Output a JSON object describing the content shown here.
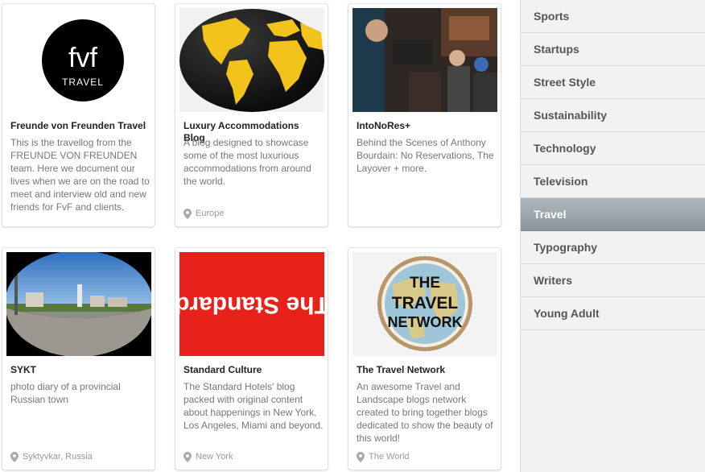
{
  "cards": [
    {
      "title": "Freunde von Freunden Travel",
      "description": "This is the travellog from the FREUNDE VON FREUNDEN team. Here we document our lives when we are on the road to meet and interview old and new friends for FvF and clients.",
      "location": "",
      "logo_text": "fvf",
      "logo_subtext": "TRAVEL"
    },
    {
      "title": "Luxury Accommodations Blog",
      "description": "A blog designed to showcase some of the most luxurious accommodations from around the world.",
      "location": "Europe"
    },
    {
      "title": "IntoNoRes+",
      "description": "Behind the Scenes of Anthony Bourdain: No Reservations, The Layover + more.",
      "location": ""
    },
    {
      "title": "SYKT",
      "description": "photo diary of a provincial Russian town",
      "location": "Syktyvkar, Russia"
    },
    {
      "title": "Standard Culture",
      "description": "The Standard Hotels' blog packed with original content about happenings in New York, Los Angeles, Miami and beyond.",
      "location": "New York",
      "logo_text": "The Standard"
    },
    {
      "title": "The Travel Network",
      "description": "An awesome Travel and Landscape blogs network created to bring together blogs dedicated to show the beauty of this world!",
      "location": "The World",
      "logo_lines": [
        "THE",
        "TRAVEL",
        "NETWORK"
      ]
    }
  ],
  "sidebar": {
    "items": [
      {
        "label": "Sports"
      },
      {
        "label": "Startups"
      },
      {
        "label": "Street Style"
      },
      {
        "label": "Sustainability"
      },
      {
        "label": "Technology"
      },
      {
        "label": "Television"
      },
      {
        "label": "Travel",
        "active": true
      },
      {
        "label": "Typography"
      },
      {
        "label": "Writers"
      },
      {
        "label": "Young Adult"
      }
    ]
  },
  "icons": {
    "location": "map-pin-icon"
  },
  "colors": {
    "standard_red": "#e8211a",
    "globe_land": "#f2c31b",
    "active_item": "#9aa3ab"
  }
}
